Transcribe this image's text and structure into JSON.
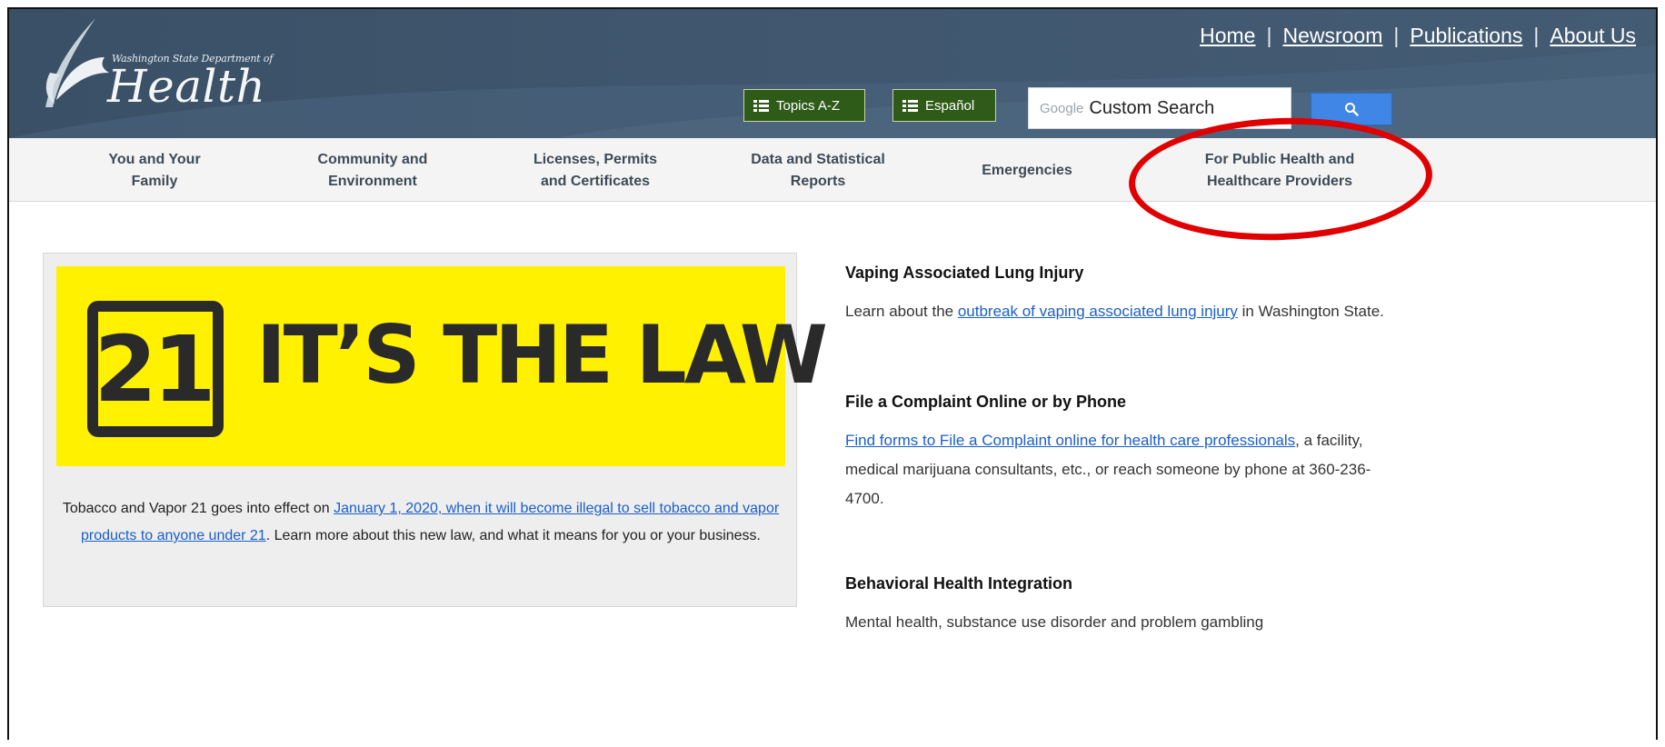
{
  "brand": {
    "department": "Washington State Department of",
    "name": "Health"
  },
  "utility_nav": [
    "Home",
    "Newsroom",
    "Publications",
    "About Us"
  ],
  "buttons": {
    "topics": "Topics A-Z",
    "espanol": "Español"
  },
  "search": {
    "google_word": "Google",
    "placeholder": "Custom Search"
  },
  "main_nav": [
    {
      "line1": "You and Your",
      "line2": "Family"
    },
    {
      "line1": "Community and",
      "line2": "Environment"
    },
    {
      "line1": "Licenses, Permits",
      "line2": "and Certificates"
    },
    {
      "line1": "Data and Statistical",
      "line2": "Reports"
    },
    {
      "line1": "Emergencies",
      "line2": ""
    },
    {
      "line1": "For Public Health and",
      "line2": "Healthcare Providers"
    }
  ],
  "feature": {
    "badge": "21",
    "headline": "IT’S THE LAW",
    "text_before": "Tobacco and Vapor 21 goes into effect on ",
    "link": "January 1, 2020, when it will become illegal to sell tobacco and vapor products to anyone under 21",
    "text_after": ". Learn more about this new law, and what it means for you or your business."
  },
  "sidebar": {
    "vaping": {
      "title": "Vaping Associated Lung Injury",
      "before": "Learn about the ",
      "link": "outbreak of vaping associated lung injury",
      "after": " in Washington State."
    },
    "complaint": {
      "title": "File a Complaint Online or by Phone",
      "link": "Find forms to File a Complaint online for health care professionals",
      "after": ", a facility, medical marijuana consultants, etc., or reach someone by phone at 360-236-4700."
    },
    "behavioral": {
      "title": "Behavioral Health Integration",
      "text": "Mental health, substance use disorder and problem gambling"
    }
  },
  "colors": {
    "masthead": "#3f566e",
    "nav_bg": "#f4f4f4",
    "green_button": "#2f5b18",
    "search_button": "#3f86e6",
    "banner_yellow": "#fff100",
    "link": "#1a5fc8",
    "annotation_red": "#e00000"
  },
  "icons": {
    "logo": "feather-swirl-icon",
    "topics": "list-icon",
    "espanol": "list-icon",
    "search": "magnifier-icon"
  }
}
